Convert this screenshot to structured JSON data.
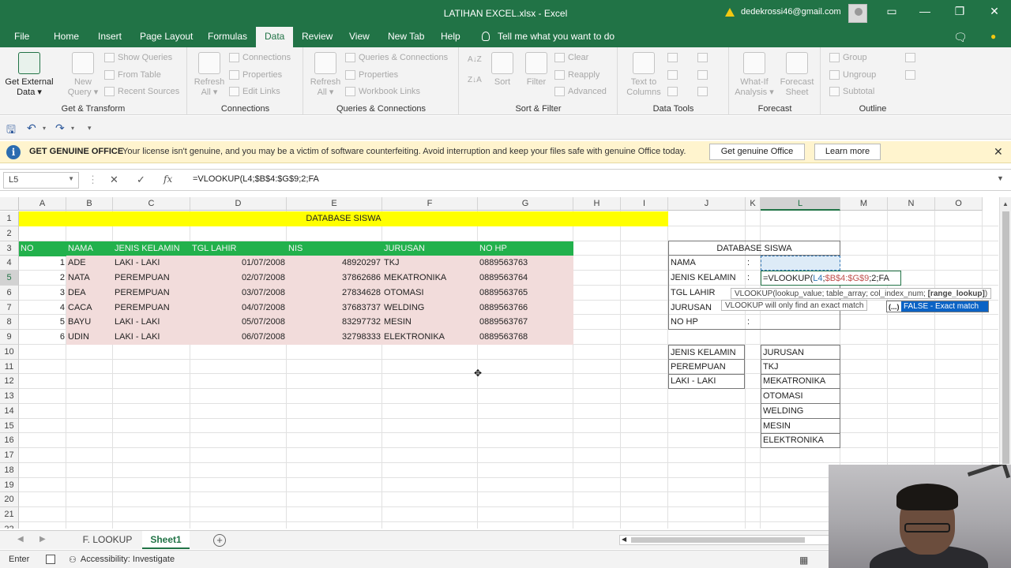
{
  "window": {
    "title": "LATIHAN EXCEL.xlsx  -  Excel",
    "account_email": "dedekrossi46@gmail.com"
  },
  "menu": {
    "tabs": [
      "File",
      "Home",
      "Insert",
      "Page Layout",
      "Formulas",
      "Data",
      "Review",
      "View",
      "New Tab",
      "Help"
    ],
    "active_tab": "Data",
    "tell_me": "Tell me what you want to do"
  },
  "ribbon": {
    "get_external": {
      "line1": "Get External",
      "line2": "Data ▾"
    },
    "new_query": {
      "line1": "New",
      "line2": "Query ▾"
    },
    "show_queries": "Show Queries",
    "from_table": "From Table",
    "recent_sources": "Recent Sources",
    "get_transform_label": "Get & Transform",
    "refresh_all_1": {
      "line1": "Refresh",
      "line2": "All ▾"
    },
    "connections": "Connections",
    "properties_1": "Properties",
    "edit_links": "Edit Links",
    "connections_label": "Connections",
    "refresh_all_2": {
      "line1": "Refresh",
      "line2": "All ▾"
    },
    "queries_connections": "Queries & Connections",
    "properties_2": "Properties",
    "workbook_links": "Workbook Links",
    "queries_label": "Queries & Connections",
    "sort": "Sort",
    "filter": "Filter",
    "clear": "Clear",
    "reapply": "Reapply",
    "advanced": "Advanced",
    "sort_filter_label": "Sort & Filter",
    "text_to_columns": {
      "line1": "Text to",
      "line2": "Columns"
    },
    "data_tools_label": "Data Tools",
    "what_if": {
      "line1": "What-If",
      "line2": "Analysis ▾"
    },
    "forecast_sheet": {
      "line1": "Forecast",
      "line2": "Sheet"
    },
    "forecast_label": "Forecast",
    "group": "Group",
    "ungroup": "Ungroup",
    "subtotal": "Subtotal",
    "outline_label": "Outline"
  },
  "infobar": {
    "title": "GET GENUINE OFFICE",
    "message": "Your license isn't genuine, and you may be a victim of software counterfeiting. Avoid interruption and keep your files safe with genuine Office today.",
    "btn_genuine": "Get genuine Office",
    "btn_learn": "Learn more"
  },
  "formula_bar": {
    "name_box": "L5",
    "formula": "=VLOOKUP(L4;$B$4:$G$9;2;FA"
  },
  "columns": [
    "A",
    "B",
    "C",
    "D",
    "E",
    "F",
    "G",
    "H",
    "I",
    "J",
    "K",
    "L",
    "M",
    "N",
    "O"
  ],
  "rows": [
    "1",
    "2",
    "3",
    "4",
    "5",
    "6",
    "7",
    "8",
    "9",
    "10",
    "11",
    "12",
    "13",
    "14",
    "15",
    "16",
    "17",
    "18",
    "19",
    "20",
    "21",
    "22"
  ],
  "sheet": {
    "title": "DATABASE SISWA",
    "headers": [
      "NO",
      "NAMA",
      "JENIS KELAMIN",
      "TGL LAHIR",
      "NIS",
      "JURUSAN",
      "NO HP"
    ],
    "data": [
      [
        "1",
        "ADE",
        "LAKI - LAKI",
        "01/07/2008",
        "48920297",
        "TKJ",
        "0889563763"
      ],
      [
        "2",
        "NATA",
        "PEREMPUAN",
        "02/07/2008",
        "37862686",
        "MEKATRONIKA",
        "0889563764"
      ],
      [
        "3",
        "DEA",
        "PEREMPUAN",
        "03/07/2008",
        "27834628",
        "OTOMASI",
        "0889563765"
      ],
      [
        "4",
        "CACA",
        "PEREMPUAN",
        "04/07/2008",
        "37683737",
        "WELDING",
        "0889563766"
      ],
      [
        "5",
        "BAYU",
        "LAKI - LAKI",
        "05/07/2008",
        "83297732",
        "MESIN",
        "0889563767"
      ],
      [
        "6",
        "UDIN",
        "LAKI - LAKI",
        "06/07/2008",
        "32798333",
        "ELEKTRONIKA",
        "0889563768"
      ]
    ]
  },
  "lookup_panel": {
    "title": "DATABASE SISWA",
    "labels": [
      "NAMA",
      "JENIS KELAMIN",
      "TGL LAHIR",
      "JURUSAN",
      "NO HP"
    ],
    "colon": ":",
    "editing_formula_prefix": "=VLOOKUP(",
    "editing_formula_arg1": "L4",
    "editing_formula_sep1": ";",
    "editing_formula_range": "$B$4:$G$9",
    "editing_formula_rest": ";2;FA"
  },
  "list_gender": [
    "JENIS KELAMIN",
    "PEREMPUAN",
    "LAKI - LAKI"
  ],
  "list_jurusan": [
    "JURUSAN",
    "TKJ",
    "MEKATRONIKA",
    "OTOMASI",
    "WELDING",
    "MESIN",
    "ELEKTRONIKA"
  ],
  "tooltip": {
    "syntax_prefix": "VLOOKUP(lookup_value; table_array; col_index_num; ",
    "syntax_bold": "[range_lookup]",
    "syntax_suffix": ")",
    "hint": "VLOOKUP will only find an exact match",
    "ac_icon": "(...)",
    "ac_option": "FALSE - Exact match"
  },
  "sheet_tabs": [
    "F. LOOKUP",
    "Sheet1"
  ],
  "active_sheet": "Sheet1",
  "status": {
    "mode": "Enter",
    "accessibility": "Accessibility: Investigate"
  },
  "colors": {
    "excel_green": "#217346",
    "title_yellow": "#ffff00",
    "header_green": "#22b14c",
    "data_pink": "#f2dcdb",
    "autocomplete_blue": "#0b63c5"
  }
}
